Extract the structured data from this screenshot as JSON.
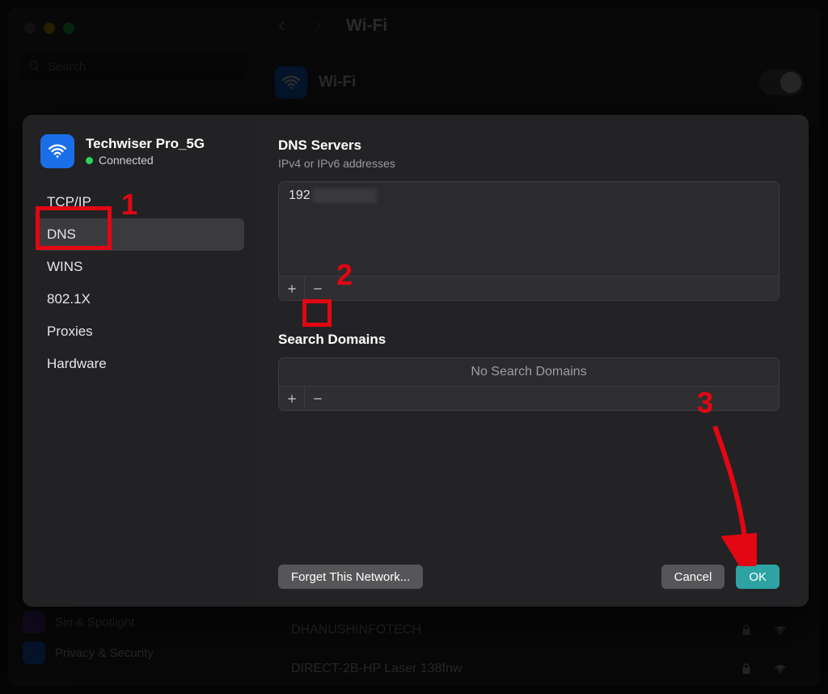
{
  "window": {
    "title": "Wi-Fi",
    "search_placeholder": "Search",
    "wifi_label": "Wi-Fi"
  },
  "sheet": {
    "network_name": "Techwiser Pro_5G",
    "status_label": "Connected",
    "tabs": [
      "TCP/IP",
      "DNS",
      "WINS",
      "802.1X",
      "Proxies",
      "Hardware"
    ],
    "dns": {
      "title": "DNS Servers",
      "subtitle": "IPv4 or IPv6 addresses",
      "entry_prefix": "192"
    },
    "search_domains": {
      "title": "Search Domains",
      "empty_label": "No Search Domains"
    },
    "buttons": {
      "forget": "Forget This Network...",
      "cancel": "Cancel",
      "ok": "OK"
    }
  },
  "background": {
    "sidebar_items": [
      "Siri & Spotlight",
      "Privacy & Security"
    ],
    "networks": [
      "DHANUSHINFOTECH",
      "DIRECT-2B-HP Laser 138fnw"
    ]
  },
  "annotations": {
    "step1": "1",
    "step2": "2",
    "step3": "3"
  }
}
